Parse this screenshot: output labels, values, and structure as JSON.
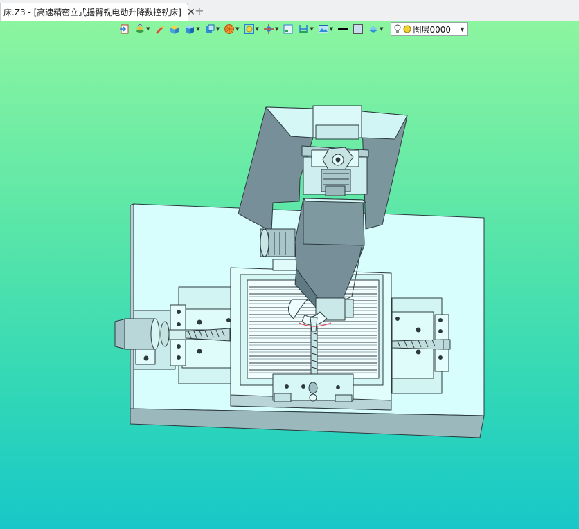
{
  "tab": {
    "title": "床.Z3 - [高速精密立式摇臂铣电动升降数控铣床]",
    "close_glyph": "✕",
    "new_tab_glyph": "+"
  },
  "toolbar": {
    "items": [
      {
        "icon": "import-icon",
        "dropdown": false
      },
      {
        "icon": "stack-layers-icon",
        "dropdown": true
      },
      {
        "icon": "pencil-icon",
        "dropdown": false
      },
      {
        "icon": "yellow-box-icon",
        "dropdown": false
      },
      {
        "icon": "blue-cube-icon",
        "dropdown": true
      },
      {
        "icon": "view-cube-icon",
        "dropdown": true
      },
      {
        "icon": "render-mode-icon",
        "dropdown": true
      },
      {
        "icon": "zoom-fit-icon",
        "dropdown": true
      },
      {
        "icon": "rotate-view-icon",
        "dropdown": true
      },
      {
        "icon": "frame-icon",
        "dropdown": false
      },
      {
        "icon": "dimension-icon",
        "dropdown": true
      },
      {
        "icon": "image-settings-icon",
        "dropdown": true
      },
      {
        "icon": "line-color-icon",
        "dropdown": false
      },
      {
        "icon": "face-color-icon",
        "dropdown": false
      },
      {
        "icon": "layer-stack-icon",
        "dropdown": true
      }
    ],
    "layer": {
      "value": "图层0000"
    }
  },
  "colors": {
    "part_fill": "#d7fdfc",
    "part_side": "#9bb8bd",
    "part_dark": "#6f8a92",
    "edge": "#2c3a40"
  }
}
